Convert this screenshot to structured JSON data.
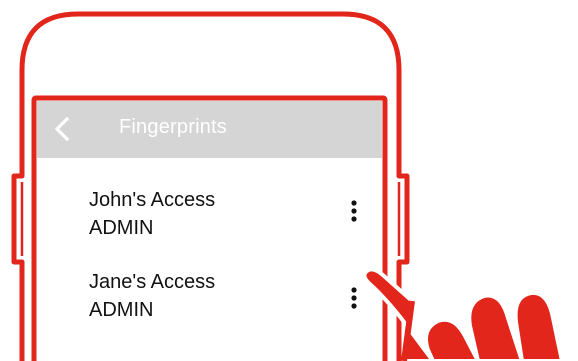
{
  "header": {
    "title": "Fingerprints",
    "back_icon": "chevron-left-icon",
    "background": "#d5d5d5"
  },
  "list": {
    "items": [
      {
        "name": "John's Access",
        "role": "ADMIN",
        "menu_icon": "more-vert-icon"
      },
      {
        "name": "Jane's Access",
        "role": "ADMIN",
        "menu_icon": "more-vert-icon"
      }
    ]
  },
  "colors": {
    "accent": "#e2261c",
    "text": "#111111",
    "header_text": "#ffffff"
  }
}
